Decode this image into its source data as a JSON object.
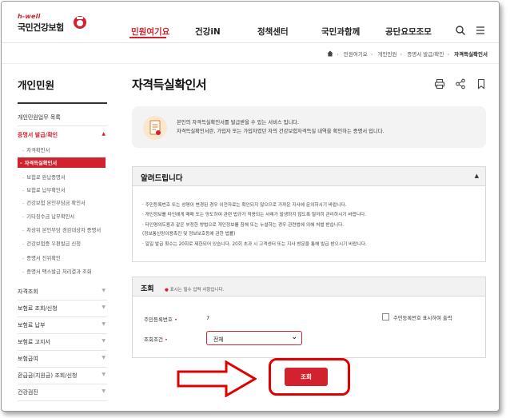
{
  "header": {
    "logo_sub": "h-well",
    "logo_main": "국민건강보험",
    "nav": [
      "민원여기요",
      "건강iN",
      "정책센터",
      "국민과함께",
      "공단요모조모"
    ],
    "icons": [
      "search-icon",
      "menu-icon"
    ]
  },
  "breadcrumb": {
    "items": [
      "민원여기요",
      "개인민원",
      "증명서 발급/확인",
      "자격득실확인서"
    ]
  },
  "sidebar": {
    "title": "개인민원",
    "sections": [
      {
        "label": "개인민원업무 목록"
      },
      {
        "label": "증명서 발급/확인",
        "open": true
      },
      {
        "label": "자격조회"
      },
      {
        "label": "보험료 조회/신청"
      },
      {
        "label": "보험료 납부"
      },
      {
        "label": "보험료 고지서"
      },
      {
        "label": "보험급여"
      },
      {
        "label": "환급금(지원금) 조회/신청"
      },
      {
        "label": "건강검진"
      }
    ],
    "sub_items": [
      "자격확인서",
      "자격득실확인서",
      "보험료 완납증명서",
      "보험료 납부확인서",
      "건강보험 본인부담금 확인서",
      "기타징수금 납부확인서",
      "차상위 본인부담 경감대상자 증명서",
      "건강보험증 우편발급 신청",
      "증명서 진위확인",
      "증명서 팩스발급 처리결과 조회"
    ],
    "active_sub": "자격득실확인서"
  },
  "main": {
    "title": "자격득실확인서",
    "tool_icons": [
      "print-icon",
      "share-icon",
      "bookmark-icon"
    ],
    "intro": {
      "line1": "본인의 자격득실확인서를 발급받을 수 있는 서비스 입니다.",
      "line2": "자격득실확인서란, 가입자 또는 가입자였던 자의 건강보험자격득실 내역을 확인하는 증명서 입니다."
    },
    "notice": {
      "title": "알려드립니다",
      "items": [
        "· 주민등록번호 또는 성명이 변경된 경우 이전자료는 확인되지 않으므로 가까운 지사에 문의하시기 바랍니다.",
        "· 개인정보를 타인에게 매매 또는 양도하여 관련 법규가 적용되는 사례가 발생하지 않도록 철저히 관리하시기 바랍니다.",
        "· 타인명의도용과 같은 부정한 방법으로 개인정보를 침해 또는 누설하는 경우 관련법에 의해 처벌 받습니다.",
        "  (정보통신망이용촉진 및 정보보호등에 관한 법률)",
        "· 일일 발급 횟수는 20회로 제한되어 있습니다. 20회 초과 시 고객센터 또는 지사 방문을 통해 발급 받으시기 바랍니다."
      ]
    },
    "search": {
      "title": "조회",
      "required_note": "표시는 필수 입력 사항입니다.",
      "rrn_label": "주민등록번호",
      "rrn_value": "7",
      "rrn_display_checkbox": "주민등록번호 표시하여 출력",
      "condition_label": "조회조건",
      "condition_value": "전체",
      "submit_label": "조회"
    }
  },
  "colors": {
    "accent": "#d2222d",
    "highlight": "#e00000"
  }
}
